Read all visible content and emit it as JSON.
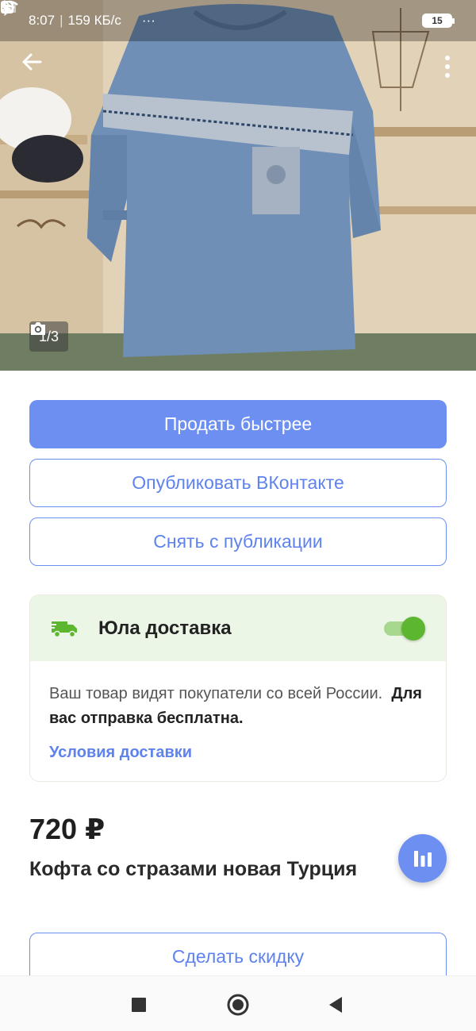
{
  "status_bar": {
    "time": "8:07",
    "network_speed": "159 КБ/с",
    "more": "···",
    "battery": "15",
    "icons": [
      "clock-circle-icon",
      "notes-icon",
      "bluetooth-icon",
      "signal-icon",
      "wifi-icon",
      "battery-icon",
      "charging-icon"
    ]
  },
  "gallery": {
    "counter": "1/3",
    "current": 1,
    "total": 3,
    "icons": [
      "back-arrow-icon",
      "more-vertical-icon",
      "camera-icon"
    ]
  },
  "actions": {
    "sell_faster": "Продать быстрее",
    "publish_vk": "Опубликовать ВКонтакте",
    "unpublish": "Снять с публикации"
  },
  "delivery": {
    "title": "Юла доставка",
    "enabled": true,
    "description": "Ваш товар видят покупатели со всей России.",
    "description_bold": "Для вас отправка бесплатна.",
    "link": "Условия доставки",
    "icon": "truck-icon"
  },
  "listing": {
    "price": "720 ₽",
    "title": "Кофта со стразами новая Турция",
    "discount_button": "Сделать скидку",
    "stats_icon": "bar-chart-icon"
  },
  "nav_bar": {
    "icons": [
      "recent-apps-icon",
      "home-icon",
      "back-icon"
    ]
  },
  "colors": {
    "accent": "#6d8ff2",
    "accent_text": "#5e82ee",
    "delivery_bg": "#ecf6e6",
    "toggle_on": "#5cb630"
  }
}
